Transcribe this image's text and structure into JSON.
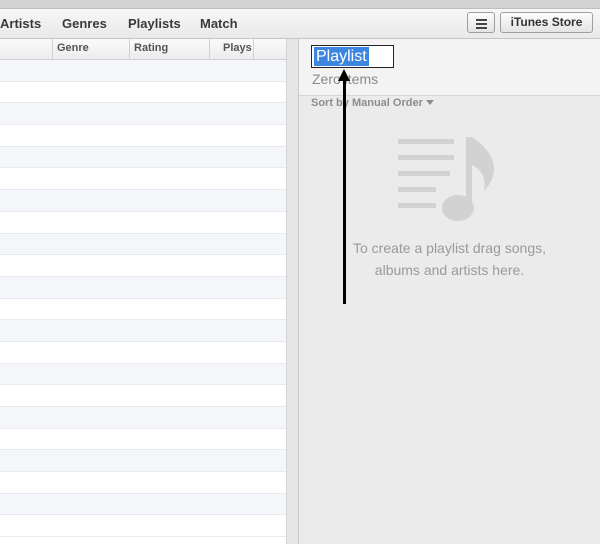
{
  "nav": {
    "tabs": [
      "Artists",
      "Genres",
      "Playlists",
      "Match"
    ],
    "menu_icon": "hamburger-icon",
    "store_button": "iTunes Store"
  },
  "song_list": {
    "columns": [
      "Genre",
      "Rating",
      "Plays"
    ],
    "row_count": 22
  },
  "playlist": {
    "name": "Playlist",
    "count": "Zero items",
    "sort_label": "Sort by Manual Order",
    "empty_icon": "playlist-music-note-icon",
    "hint_line1": "To create a playlist drag songs,",
    "hint_line2": "albums and artists here."
  },
  "annotation": {
    "type": "up-arrow",
    "color": "#000000"
  },
  "colors": {
    "selection": "#3d86e0",
    "pane_background": "#ebebeb",
    "row_alt": "#f4f6f9"
  }
}
